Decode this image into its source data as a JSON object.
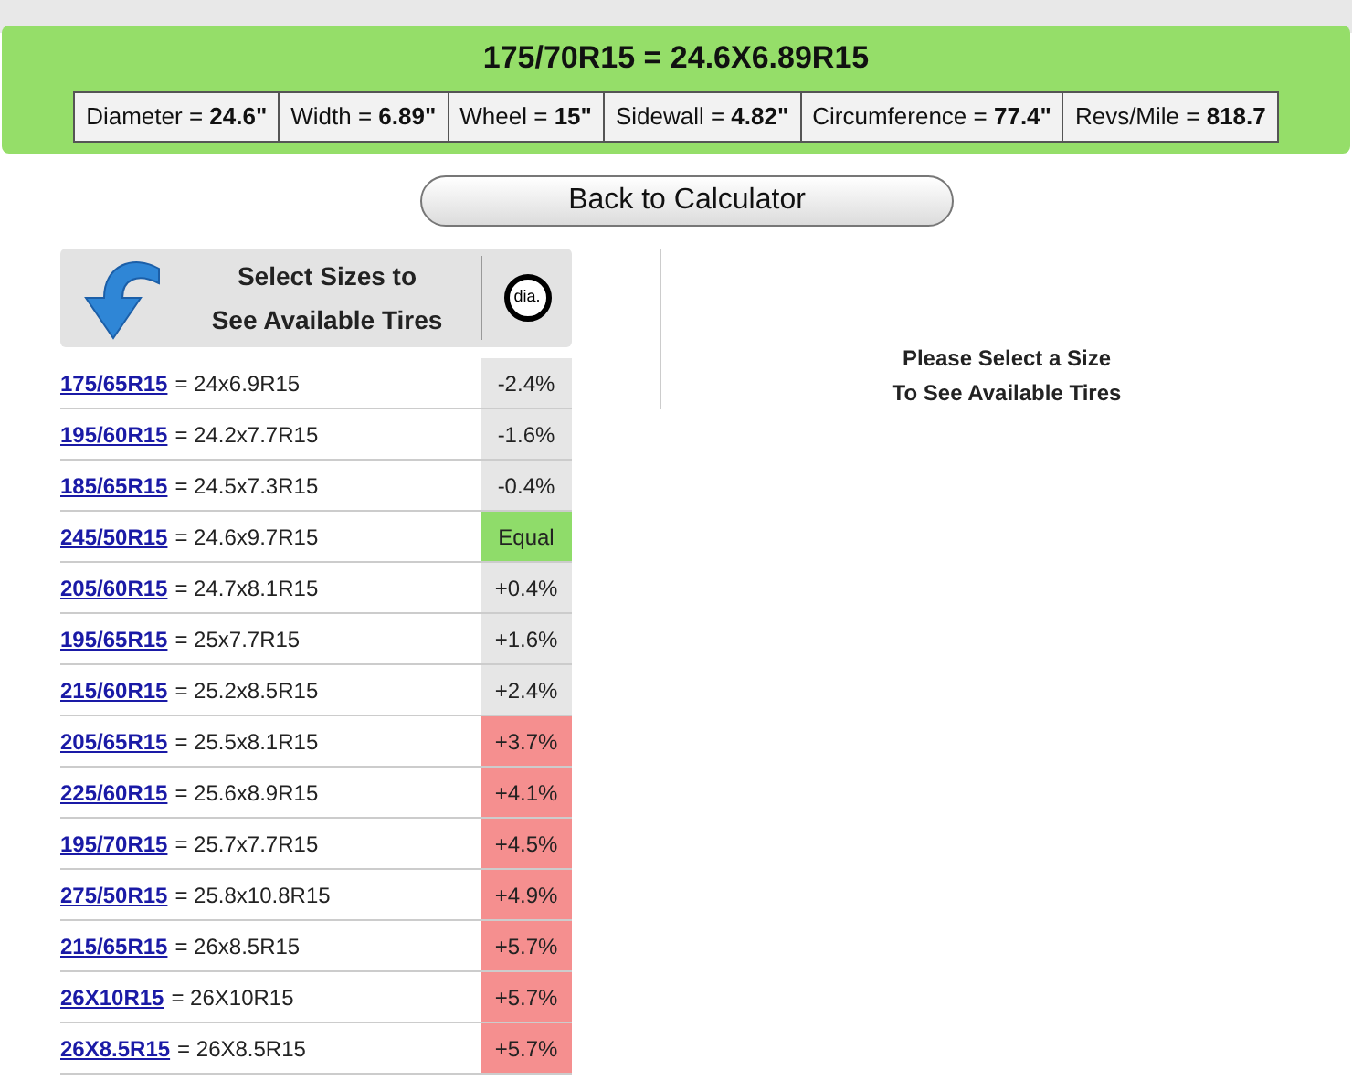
{
  "header": {
    "title": "175/70R15 = 24.6X6.89R15",
    "specs": [
      "Diameter = **24.6\"**",
      "Width = **6.89\"**",
      "Wheel = **15\"**",
      "Sidewall = **4.82\"**",
      "Circumference = **77.4\"**",
      "Revs/Mile = **818.7**"
    ]
  },
  "back_button": "Back to Calculator",
  "sizes_panel": {
    "heading": "Select Sizes to\nSee Available Tires",
    "badge": "dia.",
    "rows": [
      {
        "size": "175/65R15",
        "equiv": "= 24x6.9R15",
        "diff": "-2.4%",
        "color": "#e6e6e6"
      },
      {
        "size": "195/60R15",
        "equiv": "= 24.2x7.7R15",
        "diff": "-1.6%",
        "color": "#e6e6e6"
      },
      {
        "size": "185/65R15",
        "equiv": "= 24.5x7.3R15",
        "diff": "-0.4%",
        "color": "#e6e6e6"
      },
      {
        "size": "245/50R15",
        "equiv": "= 24.6x9.7R15",
        "diff": "Equal",
        "color": "#8fdc6a"
      },
      {
        "size": "205/60R15",
        "equiv": "= 24.7x8.1R15",
        "diff": "+0.4%",
        "color": "#e6e6e6"
      },
      {
        "size": "195/65R15",
        "equiv": "= 25x7.7R15",
        "diff": "+1.6%",
        "color": "#e6e6e6"
      },
      {
        "size": "215/60R15",
        "equiv": "= 25.2x8.5R15",
        "diff": "+2.4%",
        "color": "#e6e6e6"
      },
      {
        "size": "205/65R15",
        "equiv": "= 25.5x8.1R15",
        "diff": "+3.7%",
        "color": "#f58f8f"
      },
      {
        "size": "225/60R15",
        "equiv": "= 25.6x8.9R15",
        "diff": "+4.1%",
        "color": "#f58f8f"
      },
      {
        "size": "195/70R15",
        "equiv": "= 25.7x7.7R15",
        "diff": "+4.5%",
        "color": "#f58f8f"
      },
      {
        "size": "275/50R15",
        "equiv": "= 25.8x10.8R15",
        "diff": "+4.9%",
        "color": "#f58f8f"
      },
      {
        "size": "215/65R15",
        "equiv": "= 26x8.5R15",
        "diff": "+5.7%",
        "color": "#f58f8f"
      },
      {
        "size": "26X10R15",
        "equiv": "= 26X10R15",
        "diff": "+5.7%",
        "color": "#f58f8f"
      },
      {
        "size": "26X8.5R15",
        "equiv": "= 26X8.5R15",
        "diff": "+5.7%",
        "color": "#f58f8f"
      }
    ]
  },
  "tires_panel": {
    "message": "Please Select a Size\nTo See Available Tires"
  }
}
